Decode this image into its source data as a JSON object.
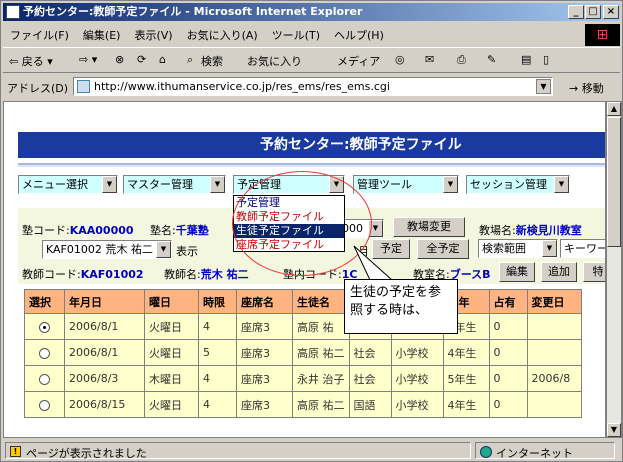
{
  "window": {
    "title": "予約センター:教師予定ファイル - Microsoft Internet Explorer",
    "btn_min": "_",
    "btn_max": "□",
    "btn_close": "×"
  },
  "menubar": [
    "ファイル(F)",
    "編集(E)",
    "表示(V)",
    "お気に入り(A)",
    "ツール(T)",
    "ヘルプ(H)"
  ],
  "toolbar": {
    "back": "⇦ 戻る ▾",
    "forward": "⇨ ▾",
    "search": "検索",
    "favorites": "お気に入り",
    "media": "メディア"
  },
  "address": {
    "label": "アドレス(D)",
    "url": "http://www.ithumanservice.co.jp/res_ems/res_ems.cgi",
    "go": "移動"
  },
  "status": {
    "left": "ページが表示されました",
    "right": "インターネット"
  },
  "page": {
    "title": "予約センター:教師予定ファイル",
    "menus": [
      "メニュー選択",
      "マスター管理",
      "予定管理",
      "管理ツール",
      "セッション管理"
    ],
    "dropdown_options": [
      "予定管理",
      "教師予定ファイル",
      "生徒予定ファイル",
      "座席予定ファイル"
    ],
    "school_code_label": "塾コード:",
    "school_code": "KAA00000",
    "school_name_label": "塾名:",
    "school_name": "千葉塾",
    "hidden_sel": "000",
    "btn_change_school": "教場変更",
    "campus_label": "教場名:",
    "campus_name": "新検見川教室",
    "teacher_select": "KAF01002 荒木 祐二",
    "display_label": "表示",
    "month_label": "月",
    "btn_schedule": "予定",
    "btn_all": "全予定",
    "search_range": "検索範囲",
    "keyword": "キーワー",
    "teacher_code_label": "教師コード:",
    "teacher_code": "KAF01002",
    "teacher_name_label": "教師名:",
    "teacher_name": "荒木 祐二",
    "school_inner_label": "塾内コード:",
    "school_inner_code": "1C",
    "room_label": "教室名:",
    "room_name": "ブースB",
    "btn_edit": "編集",
    "btn_add": "追加",
    "btn_other": "特"
  },
  "callout": "生徒の予定を参照する時は、",
  "table": {
    "headers": [
      "選択",
      "年月日",
      "曜日",
      "時限",
      "座席名",
      "生徒名",
      "",
      "",
      "学年",
      "占有",
      "変更日"
    ],
    "rows": [
      {
        "date": "2006/8/1",
        "day": "火曜日",
        "period": "4",
        "seat": "座席3",
        "student": "高原 祐",
        "subject": "",
        "school": "校",
        "grade": "4年生",
        "occ": "0",
        "changed": ""
      },
      {
        "date": "2006/8/1",
        "day": "火曜日",
        "period": "5",
        "seat": "座席3",
        "student": "高原 祐二",
        "subject": "社会",
        "school": "小学校",
        "grade": "4年生",
        "occ": "0",
        "changed": ""
      },
      {
        "date": "2006/8/3",
        "day": "木曜日",
        "period": "4",
        "seat": "座席3",
        "student": "永井 治子",
        "subject": "社会",
        "school": "小学校",
        "grade": "5年生",
        "occ": "0",
        "changed": "2006/8"
      },
      {
        "date": "2006/8/15",
        "day": "火曜日",
        "period": "4",
        "seat": "座席3",
        "student": "高原 祐二",
        "subject": "国語",
        "school": "小学校",
        "grade": "4年生",
        "occ": "0",
        "changed": ""
      }
    ]
  }
}
